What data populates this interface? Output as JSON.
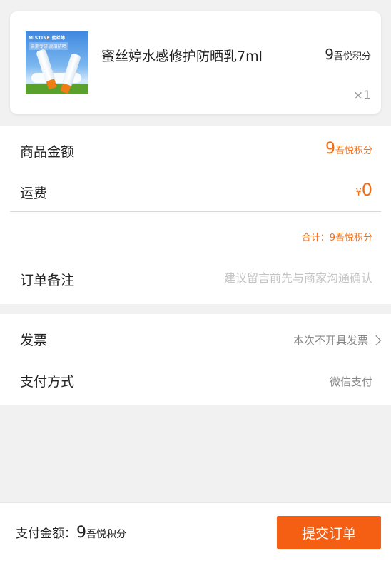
{
  "product": {
    "name": "蜜丝婷水感修护防晒乳7ml",
    "price_value": "9",
    "price_unit": "吾悦积分",
    "quantity": "×1",
    "image": {
      "brand_text": "MISTINE 蜜丝婷",
      "tag_text": "亲测专研 高倍防晒",
      "accent_color": "#ef7d16"
    }
  },
  "summary": {
    "goods_label": "商品金额",
    "goods_value": "9",
    "goods_unit": "吾悦积分",
    "freight_label": "运费",
    "freight_currency": "¥",
    "freight_value": "0",
    "total_line": "合计：9吾悦积分",
    "remark_label": "订单备注",
    "remark_placeholder": "建议留言前先与商家沟通确认"
  },
  "invoice": {
    "label": "发票",
    "value": "本次不开具发票"
  },
  "payment": {
    "label": "支付方式",
    "value": "微信支付"
  },
  "footer": {
    "amount_label": "支付金额：",
    "amount_value": "9",
    "amount_unit": "吾悦积分",
    "submit_label": "提交订单"
  },
  "colors": {
    "accent": "#f36c13",
    "button": "#f45f13",
    "background": "#f1f1f1"
  }
}
